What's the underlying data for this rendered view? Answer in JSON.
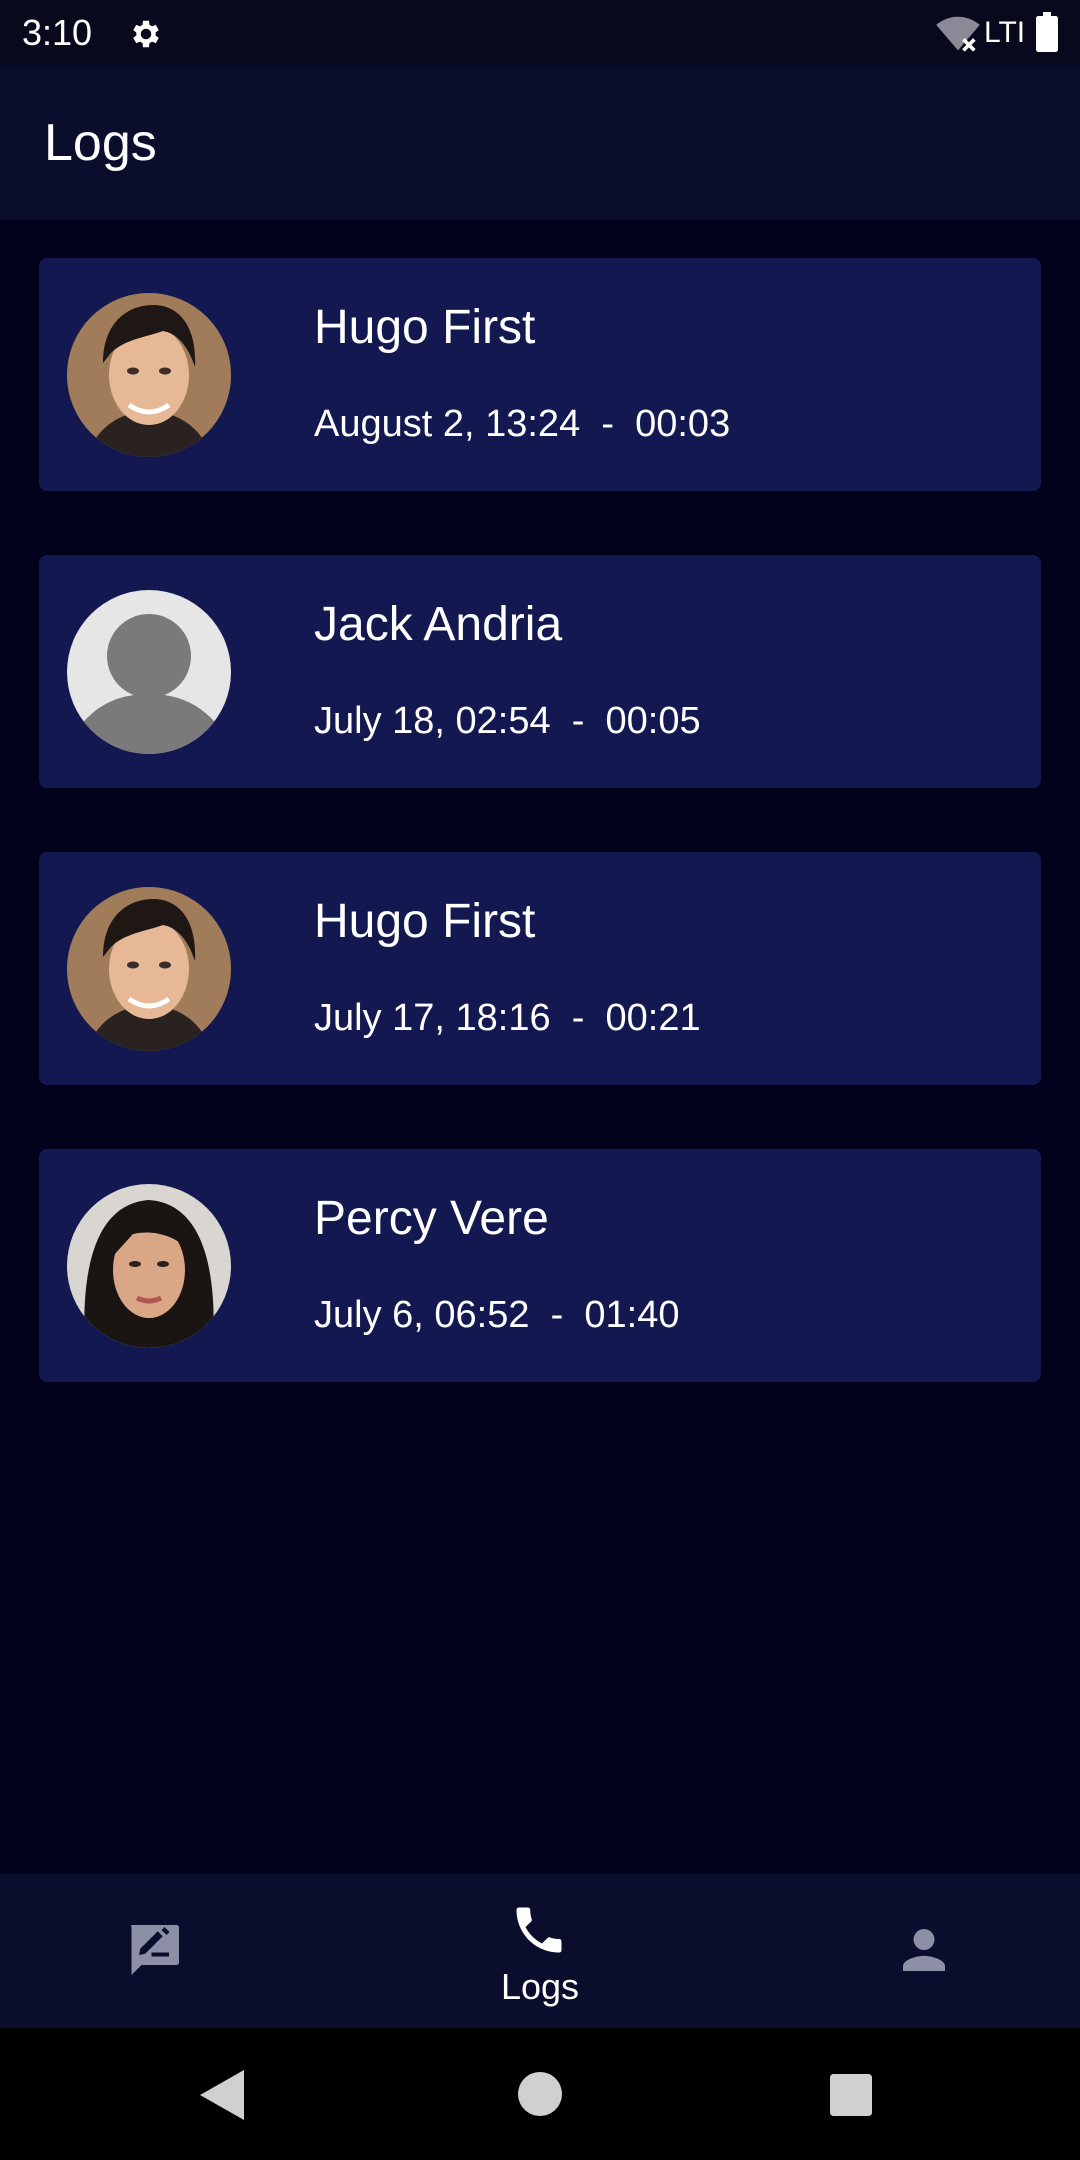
{
  "status_bar": {
    "time": "3:10",
    "network": "LTI",
    "icons": [
      "gear-icon",
      "wifi-off-icon",
      "battery-icon"
    ]
  },
  "app_bar": {
    "title": "Logs"
  },
  "logs": [
    {
      "name": "Hugo First",
      "datetime": "August 2, 13:24",
      "duration": "00:03",
      "avatar": "male-photo"
    },
    {
      "name": "Jack Andria",
      "datetime": "July 18, 02:54",
      "duration": "00:05",
      "avatar": "default-person"
    },
    {
      "name": "Hugo First",
      "datetime": "July 17, 18:16",
      "duration": "00:21",
      "avatar": "male-photo"
    },
    {
      "name": "Percy Vere",
      "datetime": "July 6, 06:52",
      "duration": "01:40",
      "avatar": "female-photo"
    }
  ],
  "bottom_nav": {
    "items": [
      {
        "icon": "messages-icon",
        "label": "",
        "active": false
      },
      {
        "icon": "phone-icon",
        "label": "Logs",
        "active": true
      },
      {
        "icon": "person-icon",
        "label": "",
        "active": false
      }
    ]
  },
  "system_nav": {
    "icons": [
      "back-icon",
      "home-icon",
      "recents-icon"
    ]
  },
  "colors": {
    "background": "#02021d",
    "bar": "#0a0d2c",
    "card": "#131950",
    "inactive_icon": "#8d8fa6"
  }
}
